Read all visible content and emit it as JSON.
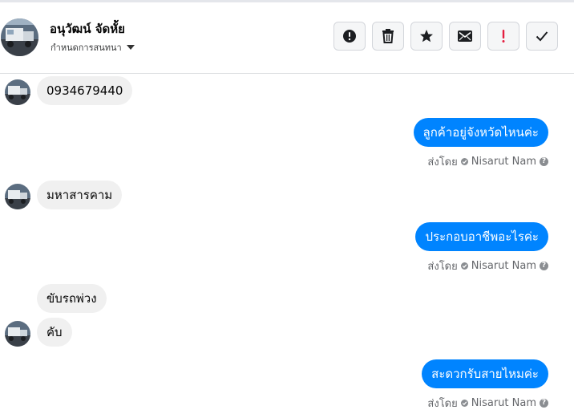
{
  "contact": {
    "name": "อนุวัฒน์ จัดหั้ย",
    "label_selector": "กำหนดการสนทนา"
  },
  "toolbar": {
    "buttons": [
      {
        "icon": "alert-circle-icon",
        "name": "report-spam-button"
      },
      {
        "icon": "trash-icon",
        "name": "delete-button"
      },
      {
        "icon": "star-icon",
        "name": "star-button"
      },
      {
        "icon": "envelope-icon",
        "name": "mark-unread-button"
      },
      {
        "icon": "exclamation-icon",
        "name": "follow-up-button"
      },
      {
        "icon": "checkmark-icon",
        "name": "mark-done-button"
      }
    ],
    "colors": {
      "icon": "#1c1e21",
      "alert": "#e41e3f"
    }
  },
  "colors": {
    "outgoing_bubble": "#0084ff",
    "incoming_bubble": "#f0f0f0",
    "secondary_text": "#65676b"
  },
  "messages": [
    {
      "direction": "in",
      "text": "0934679440"
    },
    {
      "direction": "out",
      "text": "ลูกค้าอยู่จังหวัดไหนค่ะ",
      "sent_by_label": "ส่งโดย",
      "sender": "Nisarut Nam"
    },
    {
      "direction": "in",
      "text": "มหาสารคาม"
    },
    {
      "direction": "out",
      "text": "ประกอบอาชีพอะไรค่ะ",
      "sent_by_label": "ส่งโดย",
      "sender": "Nisarut Nam"
    },
    {
      "direction": "in",
      "text": "ขับรถพ่วง"
    },
    {
      "direction": "in",
      "text": "คับ"
    },
    {
      "direction": "out",
      "text": "สะดวกรับสายไหมค่ะ",
      "sent_by_label": "ส่งโดย",
      "sender": "Nisarut Nam"
    }
  ]
}
